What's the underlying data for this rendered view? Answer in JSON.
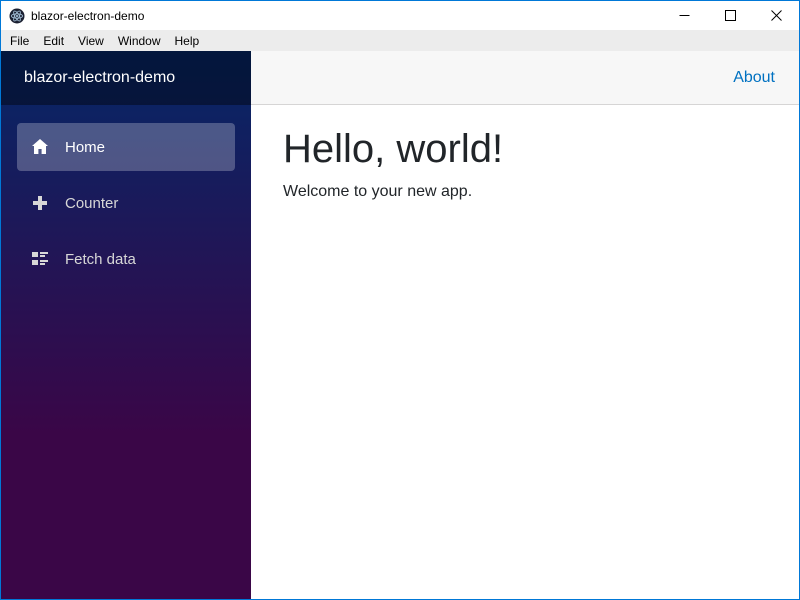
{
  "window": {
    "title": "blazor-electron-demo",
    "border_color": "#0078d7",
    "controls": [
      {
        "name": "minimize"
      },
      {
        "name": "maximize"
      },
      {
        "name": "close"
      }
    ]
  },
  "menubar": {
    "items": [
      "File",
      "Edit",
      "View",
      "Window",
      "Help"
    ]
  },
  "sidebar": {
    "brand": "blazor-electron-demo",
    "gradient_top": "#052767",
    "gradient_bottom": "#3a0647",
    "active_item_bg": "rgba(255,255,255,0.25)",
    "items": [
      {
        "label": "Home",
        "icon": "home-icon",
        "active": true
      },
      {
        "label": "Counter",
        "icon": "plus-icon",
        "active": false
      },
      {
        "label": "Fetch data",
        "icon": "list-rich-icon",
        "active": false
      }
    ]
  },
  "topbar": {
    "about_label": "About",
    "link_color": "#0071c1"
  },
  "content": {
    "heading": "Hello, world!",
    "subtitle": "Welcome to your new app."
  }
}
